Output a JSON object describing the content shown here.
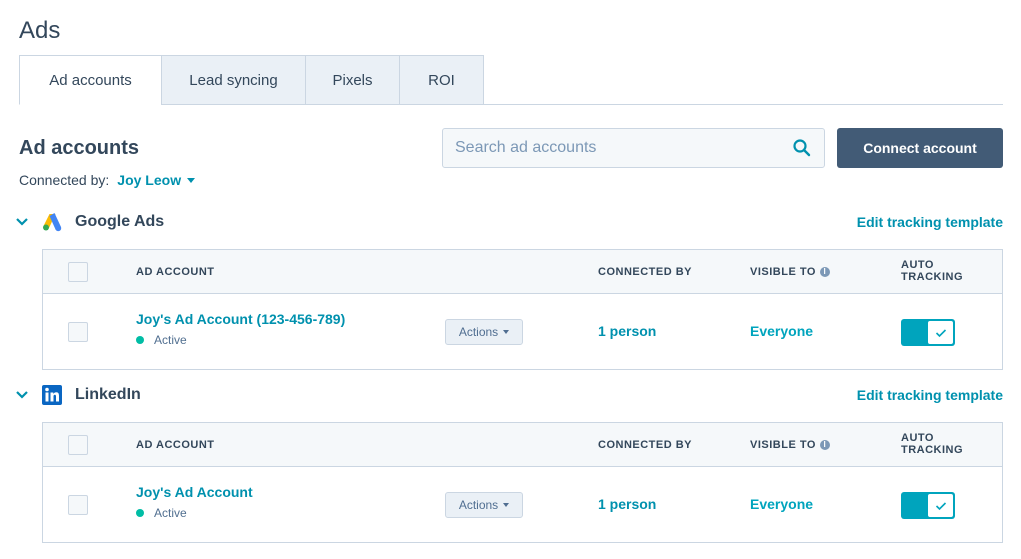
{
  "page": {
    "title": "Ads"
  },
  "tabs": [
    {
      "label": "Ad accounts",
      "active": true
    },
    {
      "label": "Lead syncing",
      "active": false
    },
    {
      "label": "Pixels",
      "active": false
    },
    {
      "label": "ROI",
      "active": false
    }
  ],
  "section": {
    "title": "Ad accounts",
    "connected_by_label": "Connected by:",
    "connected_by_user": "Joy Leow"
  },
  "search": {
    "placeholder": "Search ad accounts",
    "value": ""
  },
  "connect_button": "Connect account",
  "columns": {
    "ad_account": "AD ACCOUNT",
    "connected_by": "CONNECTED BY",
    "visible_to": "VISIBLE TO",
    "auto_tracking_1": "AUTO",
    "auto_tracking_2": "TRACKING"
  },
  "groups": [
    {
      "name": "Google Ads",
      "icon": "google-ads-icon",
      "edit_link": "Edit tracking template",
      "rows": [
        {
          "account": "Joy's Ad Account (123-456-789)",
          "status": "Active",
          "actions": "Actions",
          "connected_by": "1 person",
          "visible_to": "Everyone",
          "auto_tracking": true
        }
      ]
    },
    {
      "name": "LinkedIn",
      "icon": "linkedin-icon",
      "edit_link": "Edit tracking template",
      "rows": [
        {
          "account": "Joy's Ad Account",
          "status": "Active",
          "actions": "Actions",
          "connected_by": "1 person",
          "visible_to": "Everyone",
          "auto_tracking": true
        }
      ]
    }
  ],
  "colors": {
    "accent": "#0091ae",
    "primary_button": "#425b76",
    "toggle_on": "#00a4bd",
    "active_dot": "#00bda5"
  }
}
